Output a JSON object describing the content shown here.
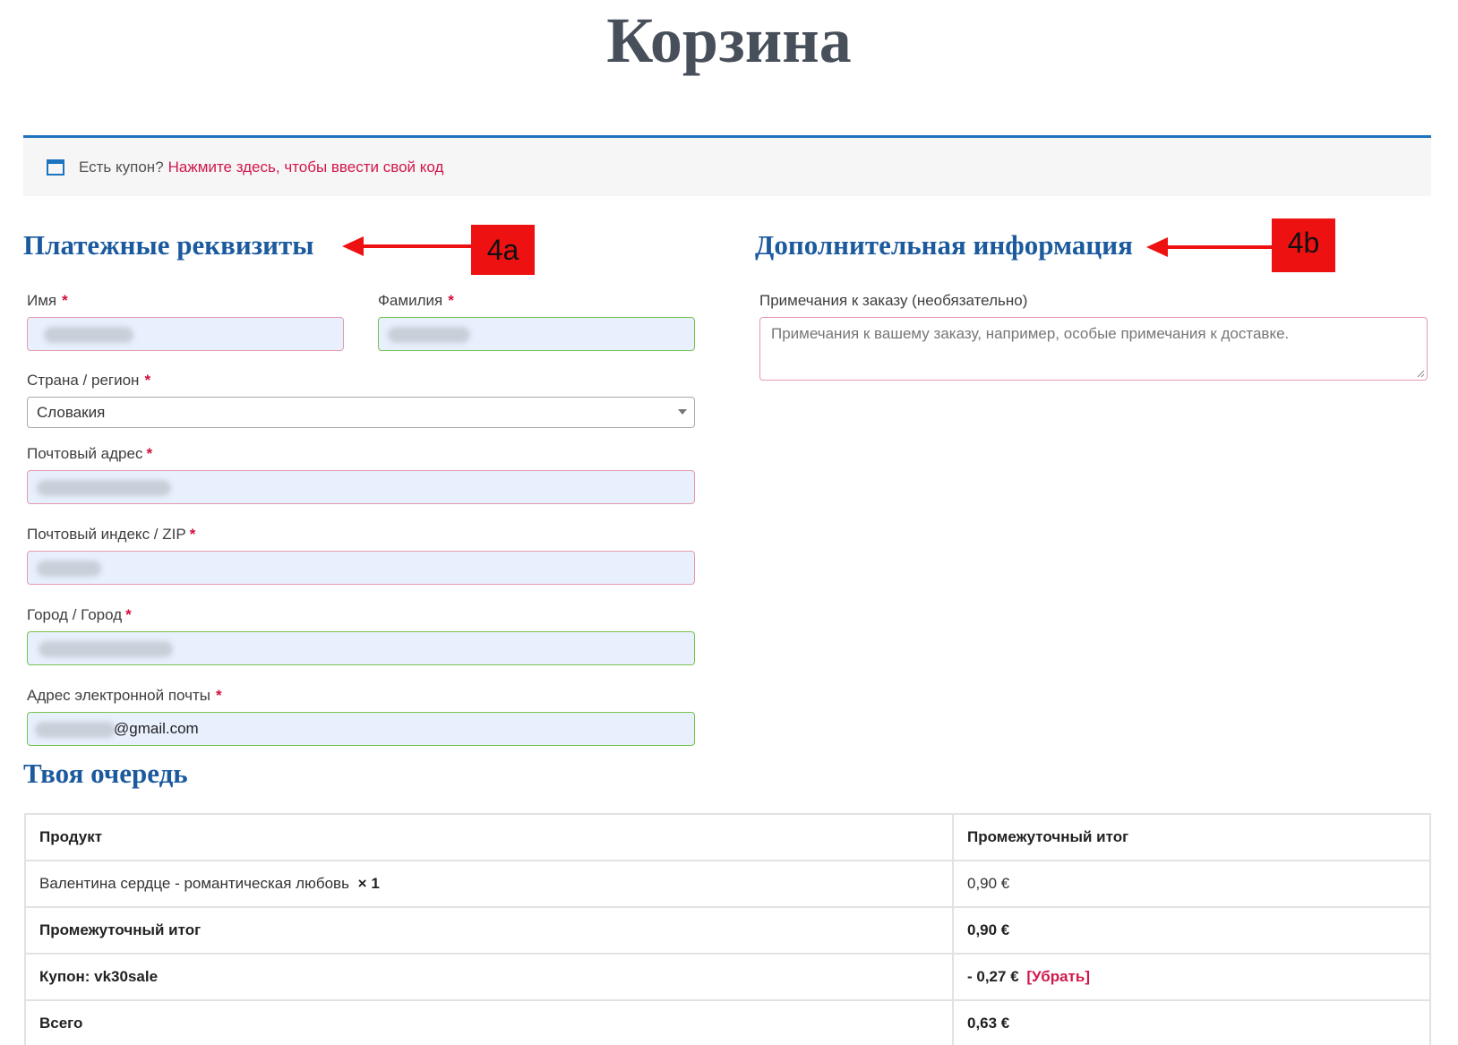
{
  "page": {
    "title": "Корзина"
  },
  "coupon_bar": {
    "icon": "calendar-icon",
    "question": "Есть купон?",
    "link": "Нажмите здесь, чтобы ввести свой код"
  },
  "billing": {
    "heading": "Платежные реквизиты",
    "first_name": {
      "label": "Имя",
      "required": "*"
    },
    "last_name": {
      "label": "Фамилия",
      "required": "*"
    },
    "country": {
      "label": "Страна / регион",
      "required": "*",
      "value": "Словакия"
    },
    "address": {
      "label": "Почтовый адрес",
      "required": "*"
    },
    "postcode": {
      "label": "Почтовый индекс / ZIP",
      "required": "*"
    },
    "city": {
      "label": "Город / Город",
      "required": "*"
    },
    "email": {
      "label": "Адрес электронной почты",
      "required": "*",
      "value_suffix": "@gmail.com"
    }
  },
  "additional": {
    "heading": "Дополнительная информация",
    "notes_label": "Примечания к  заказу (необязательно)",
    "notes_placeholder": "Примечания к вашему заказу, например, особые примечания к доставке."
  },
  "annotations": {
    "a": "4a",
    "b": "4b",
    "color": "#ee1111"
  },
  "order": {
    "heading": "Твоя очередь",
    "columns": [
      "Продукт",
      "Промежуточный итог"
    ],
    "item": {
      "name": "Валентина сердце - романтическая любовь",
      "qty": "× 1",
      "price": "0,90  €"
    },
    "subtotal": {
      "label": "Промежуточный итог",
      "value": "0,90  €"
    },
    "coupon": {
      "label": "Купон: vk30sale",
      "value": "- 0,27  €",
      "remove": "[Убрать]"
    },
    "total": {
      "label": "Всего",
      "value": "0,63  €"
    }
  },
  "colors": {
    "accent": "#1e73be",
    "heading": "#1c5a9e",
    "link": "#d0184b",
    "valid": "#76c34f",
    "invalid": "#e59aae"
  }
}
